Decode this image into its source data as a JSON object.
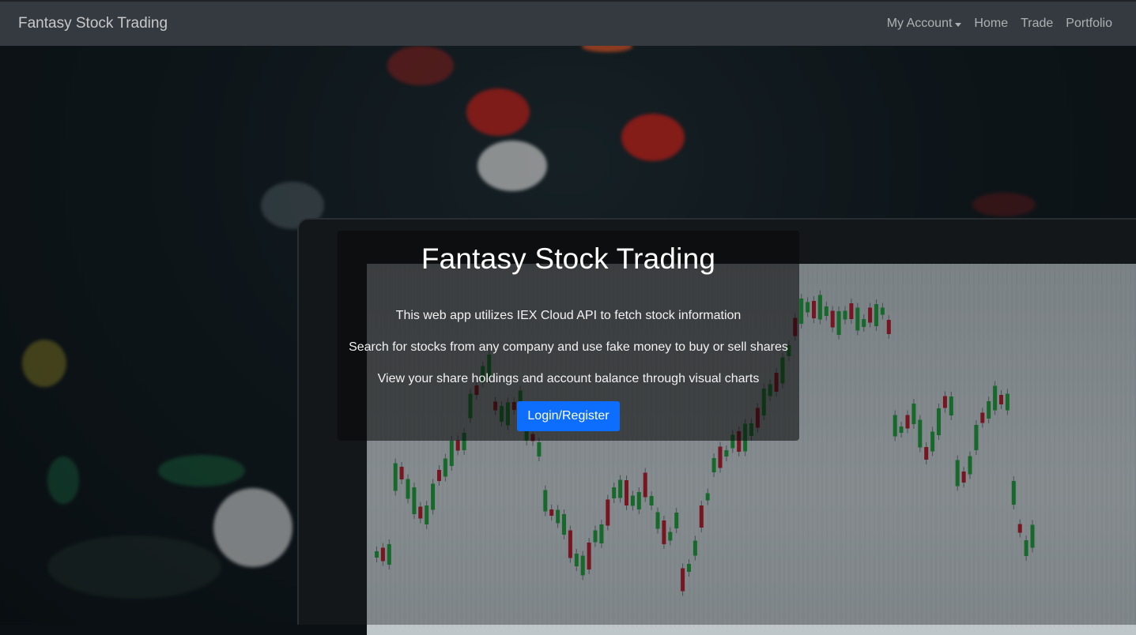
{
  "navbar": {
    "brand": "Fantasy Stock Trading",
    "links": {
      "my_account": "My Account",
      "home": "Home",
      "trade": "Trade",
      "portfolio": "Portfolio"
    }
  },
  "hero": {
    "title": "Fantasy Stock Trading",
    "lines": [
      "This web app utilizes IEX Cloud API to fetch stock information",
      "Search for stocks from any company and use fake money to buy or sell shares",
      "View your share holdings and account balance through visual charts"
    ],
    "button_label": "Login/Register"
  },
  "colors": {
    "navbar_bg": "#343a40",
    "button_bg": "#0d6efd",
    "candle_up": "#1f9a3a",
    "candle_down": "#b3192a"
  }
}
